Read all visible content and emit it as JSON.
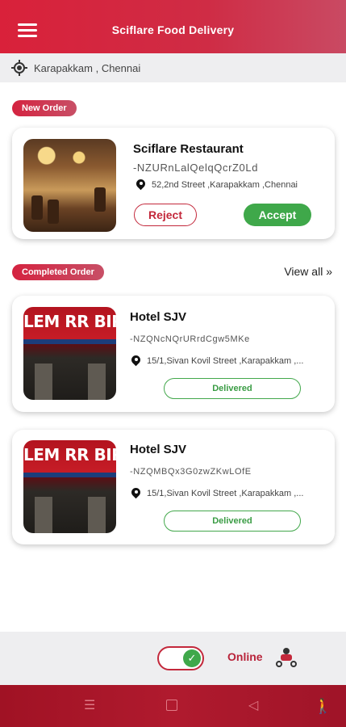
{
  "header": {
    "title": "Sciflare Food Delivery",
    "menu_icon": "hamburger-menu-icon"
  },
  "location": {
    "text": "Karapakkam , Chennai",
    "icon": "gps-target-icon"
  },
  "new_order": {
    "badge": "New Order",
    "restaurant": "Sciflare Restaurant",
    "order_id": "-NZURnLalQelqQcrZ0Ld",
    "address": "52,2nd Street ,Karapakkam ,Chennai",
    "reject_label": "Reject",
    "accept_label": "Accept"
  },
  "completed": {
    "badge": "Completed Order",
    "view_all": "View all »",
    "orders": [
      {
        "name": "Hotel SJV",
        "order_id": "-NZQNcNQrURrdCgw5MKe",
        "address": "15/1,Sivan Kovil Street ,Karapakkam ,...",
        "status": "Delivered",
        "sign": "LEM RR BIRIYAN"
      },
      {
        "name": "Hotel SJV",
        "order_id": "-NZQMBQx3G0zwZKwLOfE",
        "address": "15/1,Sivan Kovil Street ,Karapakkam ,...",
        "status": "Delivered",
        "sign": "LEM RR BIRIYAN"
      }
    ]
  },
  "status_bar": {
    "online_label": "Online",
    "toggle_on": true
  },
  "colors": {
    "brand": "#d9213a",
    "accept": "#3fa84a",
    "nav": "#a01224"
  }
}
